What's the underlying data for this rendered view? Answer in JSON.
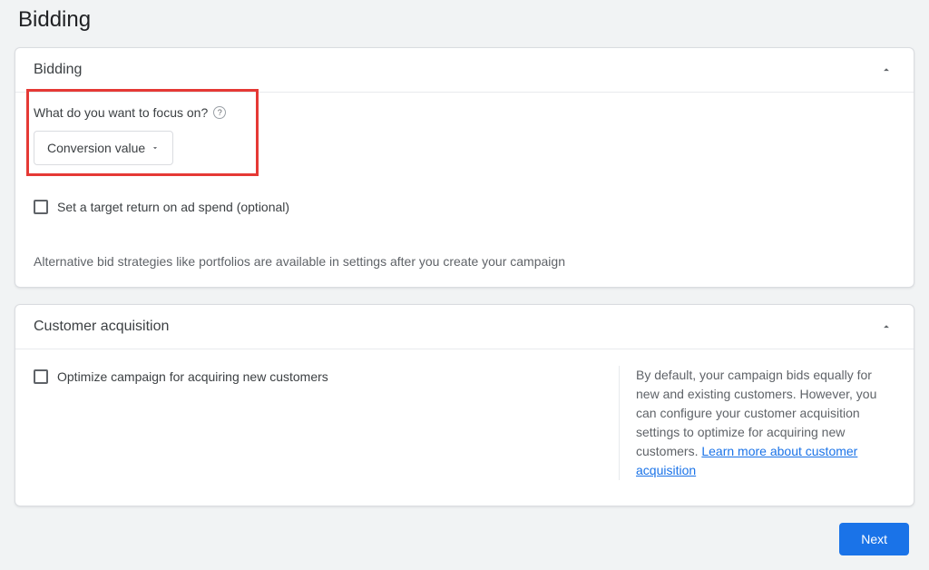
{
  "page": {
    "title": "Bidding"
  },
  "bidding": {
    "card_title": "Bidding",
    "focus_label": "What do you want to focus on?",
    "select_value": "Conversion value",
    "troas_label": "Set a target return on ad spend (optional)",
    "note": "Alternative bid strategies like portfolios are available in settings after you create your campaign"
  },
  "customer_acq": {
    "card_title": "Customer acquisition",
    "optimize_label": "Optimize campaign for acquiring new customers",
    "desc_prefix": "By default, your campaign bids equally for new and existing customers. However, you can configure your customer acquisition settings to optimize for acquiring new customers. ",
    "link_text": "Learn more about customer acquisition"
  },
  "footer": {
    "next": "Next"
  }
}
